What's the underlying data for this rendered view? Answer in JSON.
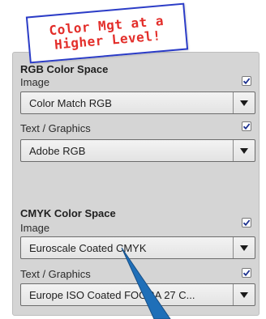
{
  "overlay": {
    "line1": "Color Mgt at a",
    "line2": "Higher Level!"
  },
  "rgb": {
    "title": "RGB Color Space",
    "image_label": "Image",
    "image_value": "Color Match RGB",
    "text_label": "Text / Graphics",
    "text_value": "Adobe RGB"
  },
  "cmyk": {
    "title": "CMYK Color Space",
    "image_label": "Image",
    "image_value": "Euroscale Coated CMYK",
    "text_label": "Text / Graphics",
    "text_value": "Europe ISO Coated FOGRA 27 C..."
  },
  "colors": {
    "overlay_border": "#2b3cc7",
    "overlay_text": "#e32e2a",
    "pointer": "#1f6fb8",
    "panel": "#d5d5d5"
  },
  "icons": {
    "checkbox": "checkmark-icon",
    "dropdown": "chevron-down-icon",
    "pointer": "arrow-pointer-icon"
  }
}
